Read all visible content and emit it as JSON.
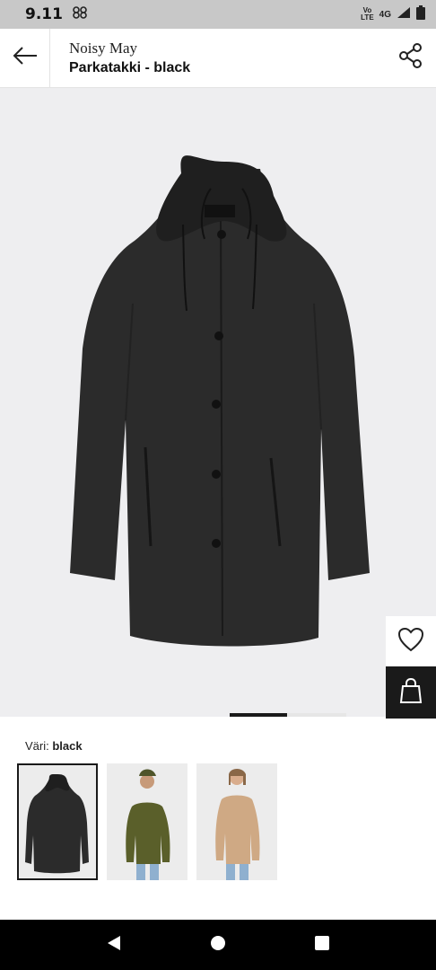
{
  "status": {
    "time": "9.11",
    "volte_top": "Vo",
    "volte_bottom": "LTE",
    "network": "4G"
  },
  "header": {
    "brand": "Noisy May",
    "product_name": "Parkatakki - black"
  },
  "product": {
    "color_prefix": "Väri:",
    "color_value": "black",
    "image_index": 2,
    "image_count": 2
  },
  "icons": {
    "back": "arrow-left-icon",
    "share": "share-icon",
    "wishlist": "heart-icon",
    "cart": "shopping-bag-icon",
    "nav_back": "triangle-back-icon",
    "nav_home": "circle-home-icon",
    "nav_recents": "square-recents-icon"
  },
  "colors": {
    "accent": "#1a1a1a",
    "image_bg": "#eeeef0",
    "olive": "#5a5f2a",
    "beige": "#cfa984"
  }
}
